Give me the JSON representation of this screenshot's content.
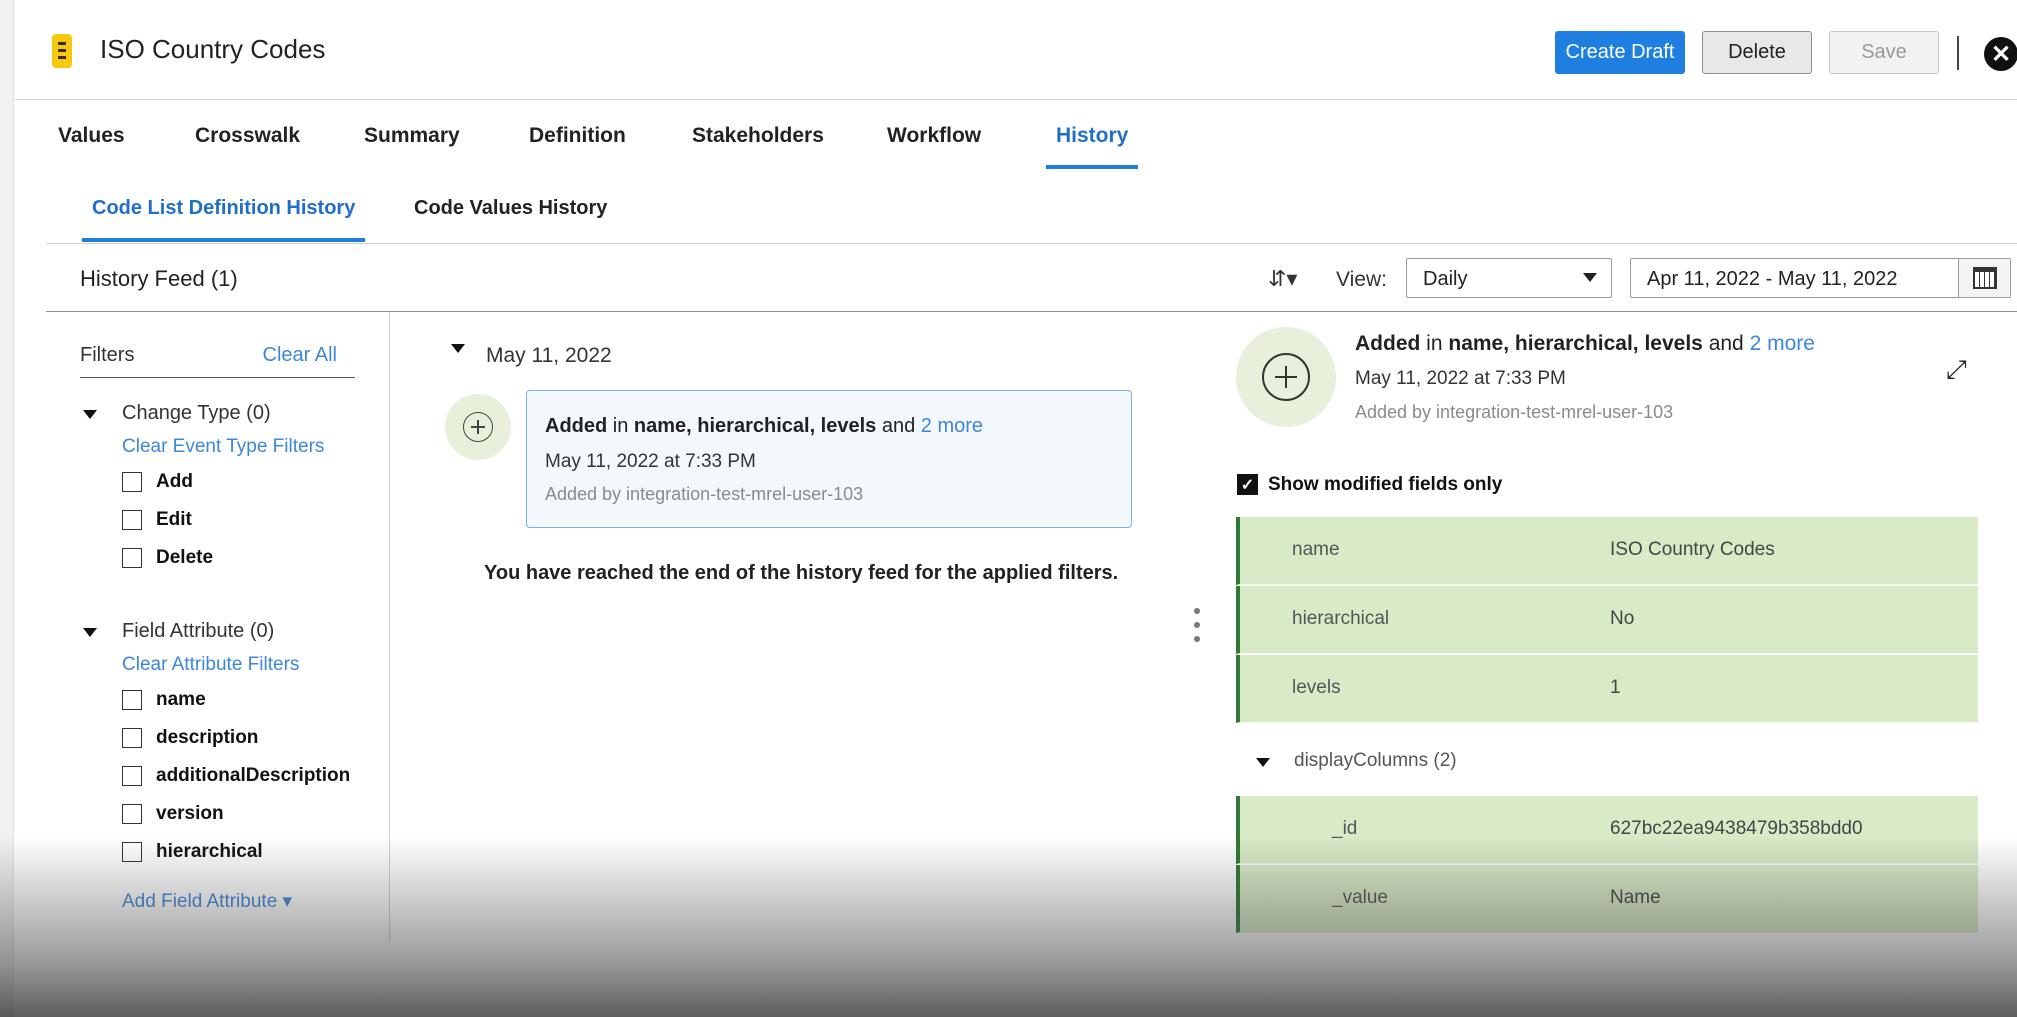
{
  "header": {
    "title": "ISO Country Codes",
    "create_draft": "Create Draft",
    "delete": "Delete",
    "save": "Save",
    "close_icon": "close-icon"
  },
  "tabs": [
    "Values",
    "Crosswalk",
    "Summary",
    "Definition",
    "Stakeholders",
    "Workflow",
    "History"
  ],
  "active_tab": "History",
  "subtabs": [
    "Code List Definition History",
    "Code Values History"
  ],
  "active_subtab": "Code List Definition History",
  "feed": {
    "title": "History Feed (1)",
    "view_label": "View:",
    "view_value": "Daily",
    "date_range": "Apr 11, 2022 - May 11, 2022",
    "sort_icon": "sort-icon",
    "calendar_icon": "calendar-icon"
  },
  "filters": {
    "title": "Filters",
    "clear_all": "Clear All",
    "change_type": {
      "label": "Change Type (0)",
      "clear": "Clear Event Type Filters",
      "options": [
        "Add",
        "Edit",
        "Delete"
      ]
    },
    "field_attribute": {
      "label": "Field Attribute (0)",
      "clear": "Clear Attribute Filters",
      "options": [
        "name",
        "description",
        "additionalDescription",
        "version",
        "hierarchical"
      ],
      "add": "Add Field Attribute"
    }
  },
  "timeline": {
    "date": "May 11, 2022",
    "event": {
      "action": "Added",
      "in": "in",
      "fields": "name, hierarchical, levels",
      "and": "and",
      "more": "2 more",
      "time": "May 11, 2022 at 7:33 PM",
      "by": "Added by integration-test-mrel-user-103"
    },
    "end_message": "You have reached the end of the history feed for the applied filters."
  },
  "details": {
    "action": "Added",
    "in": "in",
    "fields": "name, hierarchical, levels",
    "and": "and",
    "more": "2 more",
    "time": "May 11, 2022 at 7:33 PM",
    "by": "Added by integration-test-mrel-user-103",
    "show_modified": "Show modified fields only",
    "rows": [
      {
        "key": "name",
        "value": "ISO Country Codes"
      },
      {
        "key": "hierarchical",
        "value": "No"
      },
      {
        "key": "levels",
        "value": "1"
      }
    ],
    "display_columns": {
      "label": "displayColumns (2)",
      "rows": [
        {
          "key": "_id",
          "value": "627bc22ea9438479b358bdd0"
        },
        {
          "key": "_value",
          "value": "Name"
        }
      ]
    }
  },
  "colors": {
    "primary": "#1f7fe0",
    "link": "#3d87d8",
    "row_bg": "#d8eac6",
    "row_border": "#2f7a36",
    "event_circle": "#e6f0da"
  }
}
